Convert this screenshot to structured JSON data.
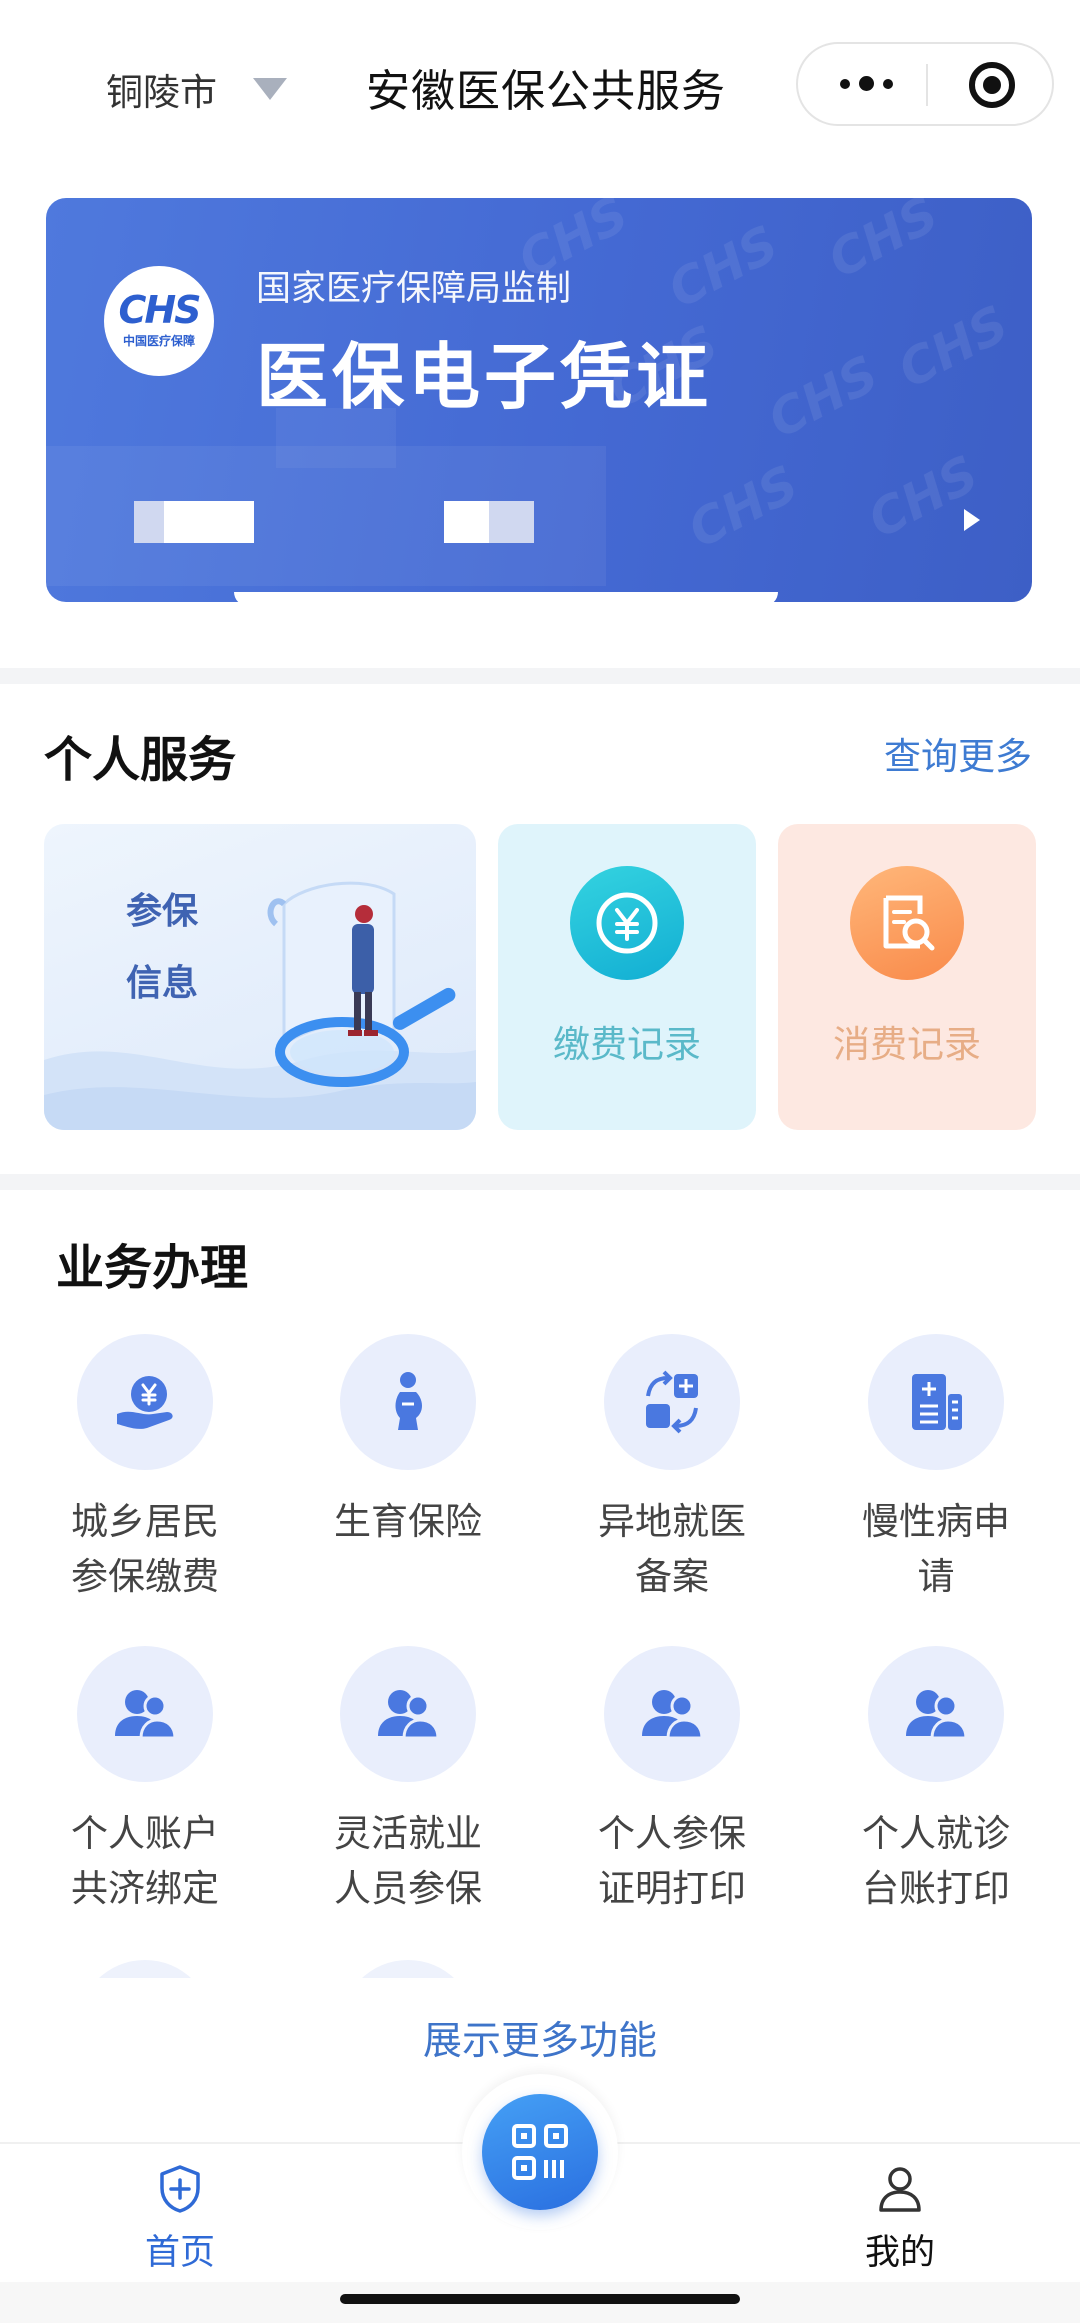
{
  "header": {
    "city": "铜陵市",
    "title": "安徽医保公共服务"
  },
  "card": {
    "logo_text": "CHS",
    "logo_subtext": "中国医疗保障",
    "subtitle": "国家医疗保障局监制",
    "title": "医保电子凭证"
  },
  "personal_service": {
    "title": "个人服务",
    "more": "查询更多",
    "insurance_info": [
      "参保",
      "信息"
    ],
    "payment_record": "缴费记录",
    "consumption_record": "消费记录"
  },
  "business": {
    "title": "业务办理",
    "items": [
      {
        "label": "城乡居民\n参保缴费",
        "icon": "yuan-hand-icon"
      },
      {
        "label": "生育保险",
        "icon": "pregnancy-icon"
      },
      {
        "label": "异地就医\n备案",
        "icon": "transfer-medical-icon"
      },
      {
        "label": "慢性病申\n请",
        "icon": "medical-document-icon"
      },
      {
        "label": "个人账户\n共济绑定",
        "icon": "users-icon"
      },
      {
        "label": "灵活就业\n人员参保",
        "icon": "users-icon"
      },
      {
        "label": "个人参保\n证明打印",
        "icon": "users-icon"
      },
      {
        "label": "个人就诊\n台账打印",
        "icon": "users-icon"
      }
    ],
    "show_more": "展示更多功能"
  },
  "tabbar": {
    "home": "首页",
    "mine": "我的"
  },
  "colors": {
    "accent": "#3e7bd2",
    "card_blue": "#4469d3",
    "icon_bg": "#e9eefc",
    "icon_fg": "#4a78e0"
  }
}
